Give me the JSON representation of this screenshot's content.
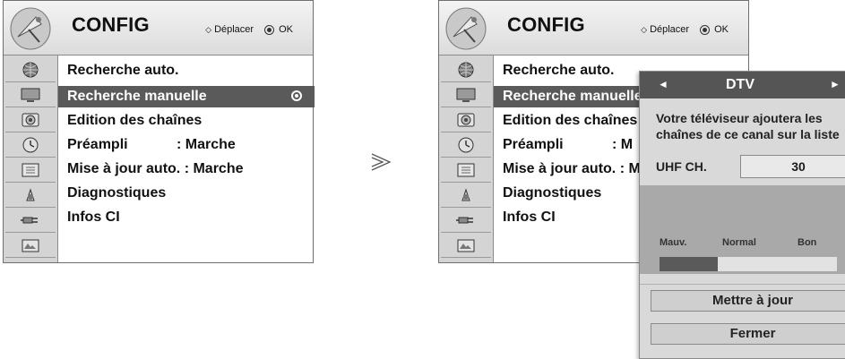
{
  "left_panel": {
    "title": "CONFIG",
    "hint_move": "Déplacer",
    "hint_ok": "OK",
    "items": [
      {
        "label": "Recherche auto.",
        "value": ""
      },
      {
        "label": "Recherche manuelle",
        "value": "",
        "selected": true
      },
      {
        "label": "Edition des chaînes",
        "value": ""
      },
      {
        "label": "Préampli",
        "value": ": Marche"
      },
      {
        "label": "Mise à jour auto. : Marche",
        "value": ""
      },
      {
        "label": "Diagnostiques",
        "value": ""
      },
      {
        "label": "Infos CI",
        "value": ""
      }
    ]
  },
  "right_panel": {
    "title": "CONFIG",
    "hint_move": "Déplacer",
    "hint_ok": "OK",
    "items": [
      {
        "label": "Recherche auto.",
        "value": ""
      },
      {
        "label": "Recherche manuelle",
        "value": "",
        "selected": true
      },
      {
        "label": "Edition des chaînes",
        "value": ""
      },
      {
        "label": "Préampli",
        "value": ": M"
      },
      {
        "label": "Mise à jour auto. : M",
        "value": ""
      },
      {
        "label": "Diagnostiques",
        "value": ""
      },
      {
        "label": "Infos CI",
        "value": ""
      }
    ]
  },
  "icons": [
    "globe-icon",
    "tv-screen-icon",
    "speaker-icon",
    "clock-icon",
    "lock-icon",
    "tools-icon",
    "plug-icon",
    "tv-setup-icon"
  ],
  "transition_symbol": "≫",
  "popup": {
    "left_arrow": "◄",
    "mode": "DTV",
    "right_arrow": "►",
    "message": "Votre téléviseur ajoutera les chaînes de ce canal sur la liste",
    "message_line1": "Votre téléviseur ajoutera les",
    "message_line2": "chaînes de ce canal sur la liste",
    "uhf_label": "UHF CH.",
    "uhf_value": "30",
    "signal_labels": [
      "Mauv.",
      "Normal",
      "Bon"
    ],
    "signal_level_fraction": 0.33,
    "update_button": "Mettre à jour",
    "close_button": "Fermer"
  },
  "colors": {
    "highlight": "#5a5a5a",
    "popup_header": "#555555",
    "signal_area": "#a9a9a9"
  }
}
